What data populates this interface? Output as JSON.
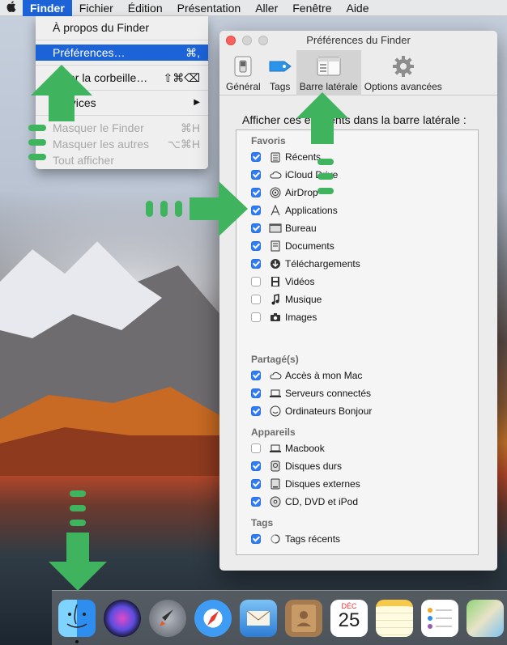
{
  "menubar": {
    "apple_icon": "apple-icon",
    "items": [
      "Finder",
      "Fichier",
      "Édition",
      "Présentation",
      "Aller",
      "Fenêtre",
      "Aide"
    ]
  },
  "finder_menu": {
    "about": "À propos du Finder",
    "preferences": "Préférences…",
    "preferences_shortcut": "⌘,",
    "empty_trash": "Vider la corbeille…",
    "empty_trash_shortcut": "⇧⌘⌫",
    "services": "Services",
    "services_arrow": "▶",
    "hide_finder": "Masquer le Finder",
    "hide_finder_shortcut": "⌘H",
    "hide_others": "Masquer les autres",
    "hide_others_shortcut": "⌥⌘H",
    "show_all": "Tout afficher"
  },
  "window": {
    "title": "Préférences du Finder",
    "toolbar": [
      {
        "label": "Général",
        "icon": "switch-icon"
      },
      {
        "label": "Tags",
        "icon": "tag-icon"
      },
      {
        "label": "Barre latérale",
        "icon": "sidebar-icon"
      },
      {
        "label": "Options avancées",
        "icon": "gear-icon"
      }
    ],
    "heading": "Afficher ces éléments dans la barre latérale :",
    "groups": {
      "favoris": {
        "title": "Favoris",
        "items": [
          {
            "label": "Récents",
            "checked": true,
            "icon": "recents-icon"
          },
          {
            "label": "iCloud Drive",
            "checked": true,
            "icon": "cloud-icon"
          },
          {
            "label": "AirDrop",
            "checked": true,
            "icon": "airdrop-icon"
          },
          {
            "label": "Applications",
            "checked": true,
            "icon": "applications-icon"
          },
          {
            "label": "Bureau",
            "checked": true,
            "icon": "desktop-icon"
          },
          {
            "label": "Documents",
            "checked": true,
            "icon": "documents-icon"
          },
          {
            "label": "Téléchargements",
            "checked": true,
            "icon": "download-icon"
          },
          {
            "label": "Vidéos",
            "checked": false,
            "icon": "film-icon"
          },
          {
            "label": "Musique",
            "checked": false,
            "icon": "music-note-icon"
          },
          {
            "label": "Images",
            "checked": false,
            "icon": "camera-icon"
          }
        ]
      },
      "partage": {
        "title": "Partagé(s)",
        "items": [
          {
            "label": "Accès à mon Mac",
            "checked": true,
            "icon": "cloud-icon"
          },
          {
            "label": "Serveurs connectés",
            "checked": true,
            "icon": "laptop-icon"
          },
          {
            "label": "Ordinateurs Bonjour",
            "checked": true,
            "icon": "bonjour-icon"
          }
        ]
      },
      "appareils": {
        "title": "Appareils",
        "items": [
          {
            "label": "Macbook",
            "checked": false,
            "icon": "laptop-icon"
          },
          {
            "label": "Disques durs",
            "checked": true,
            "icon": "hard-drive-icon"
          },
          {
            "label": "Disques externes",
            "checked": true,
            "icon": "external-drive-icon"
          },
          {
            "label": "CD, DVD et iPod",
            "checked": true,
            "icon": "disc-icon"
          }
        ]
      },
      "tags": {
        "title": "Tags",
        "items": [
          {
            "label": "Tags récents",
            "checked": true,
            "icon": "tag-circle-icon"
          }
        ]
      }
    }
  },
  "dock": {
    "calendar_month": "DÉC",
    "calendar_day": "25",
    "apps": [
      "finder-icon",
      "siri-icon",
      "launchpad-icon",
      "safari-icon",
      "mail-icon",
      "contacts-icon",
      "calendar-icon",
      "notes-icon",
      "reminders-icon",
      "maps-icon"
    ]
  },
  "colors": {
    "menu_selection": "#1c63d8",
    "checkbox_on": "#2f7cf6",
    "annotation_green": "#3fb35e"
  }
}
